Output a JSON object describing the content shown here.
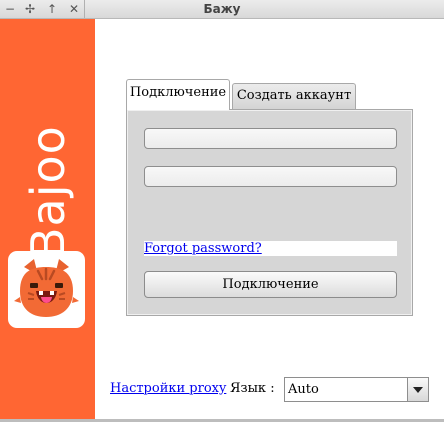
{
  "window": {
    "title": "Бажу",
    "controls": [
      {
        "name": "minimize-icon",
        "glyph": "−"
      },
      {
        "name": "expand-icon",
        "glyph": "✢"
      },
      {
        "name": "arrow-up-icon",
        "glyph": "↑"
      },
      {
        "name": "close-icon",
        "glyph": "✕"
      }
    ]
  },
  "brand": {
    "name": "Bajoo",
    "color": "#ff6633",
    "logo_icon": "cat-mascot-icon"
  },
  "tabs": [
    {
      "label": "Подключение",
      "active": true
    },
    {
      "label": "Создать аккаунт",
      "active": false
    }
  ],
  "login": {
    "email_value": "",
    "password_value": "",
    "forgot_link": "Forgot password?",
    "connect_button": "Подключение"
  },
  "footer": {
    "proxy_link": "Настройки proxy",
    "language_label": "Язык :",
    "language_value": "Auto"
  }
}
